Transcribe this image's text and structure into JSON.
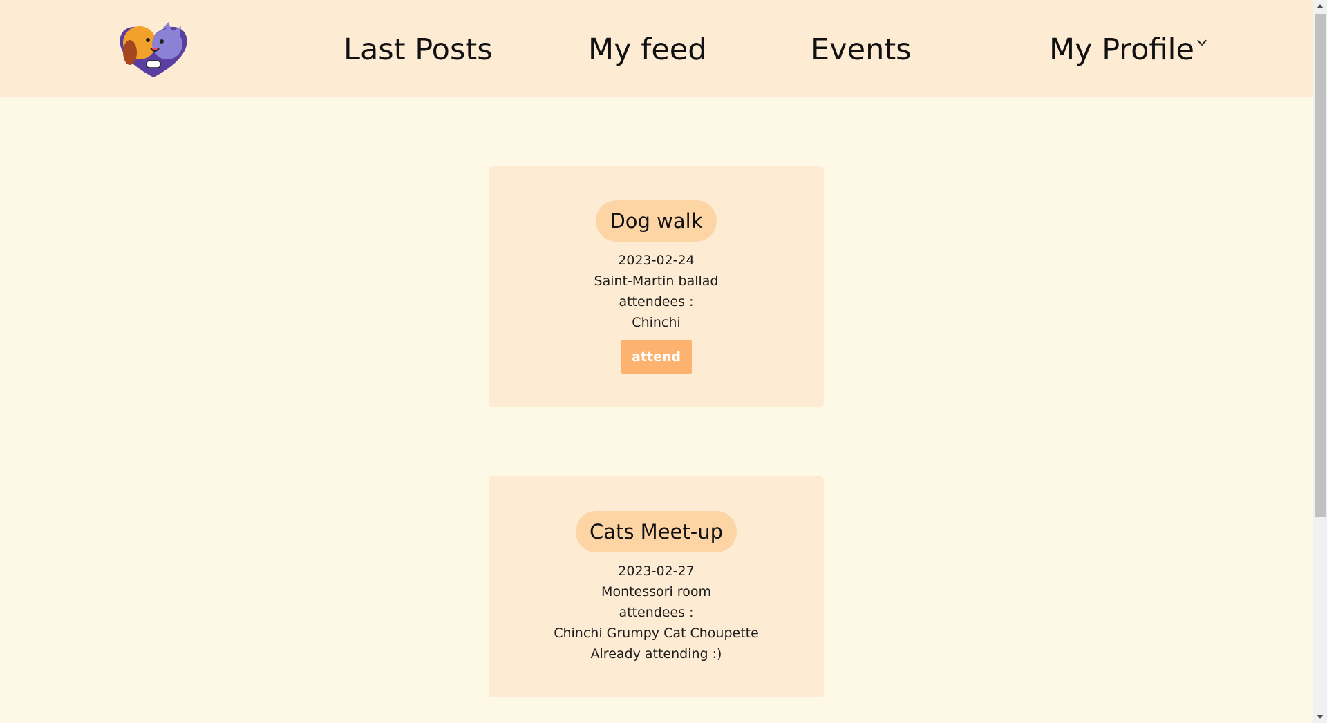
{
  "navbar": {
    "logo_icon": "dog-and-cat-hug-logo-icon",
    "links": {
      "last_posts": "Last Posts",
      "my_feed": "My feed",
      "events": "Events",
      "my_profile": "My Profile"
    }
  },
  "events": [
    {
      "title": "Dog walk",
      "date": "2023-02-24",
      "location": "Saint-Martin ballad",
      "attendees_label": "attendees :",
      "attendees": "Chinchi",
      "action_label": "attend"
    },
    {
      "title": "Cats Meet-up",
      "date": "2023-02-27",
      "location": "Montessori room",
      "attendees_label": "attendees :",
      "attendees": "Chinchi Grumpy Cat Choupette",
      "status": "Already attending :)"
    }
  ],
  "colors": {
    "page_bg": "#FEF8E6",
    "navbar_bg": "#FEEBD3",
    "card_bg": "#FEEBD3",
    "pill_bg": "#FDD5A5",
    "button_bg": "#FDB36F"
  }
}
